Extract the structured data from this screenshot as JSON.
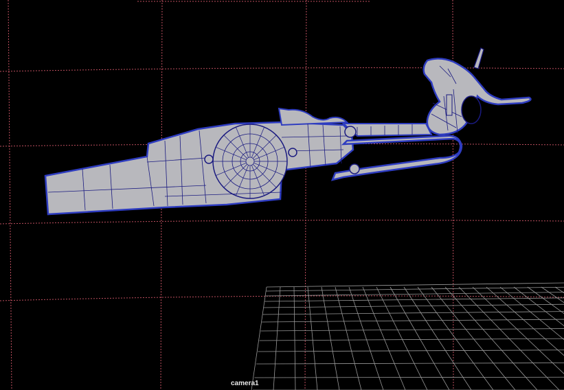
{
  "viewport": {
    "camera_label": "camera1",
    "background_color": "#000000",
    "ref_grid_color": "#c05060",
    "floor_grid_color": "#9a9a9a",
    "mesh_fill_color": "#b8b8bd",
    "wire_color": "#1a1a80",
    "selection_color": "#2e3cc0"
  }
}
